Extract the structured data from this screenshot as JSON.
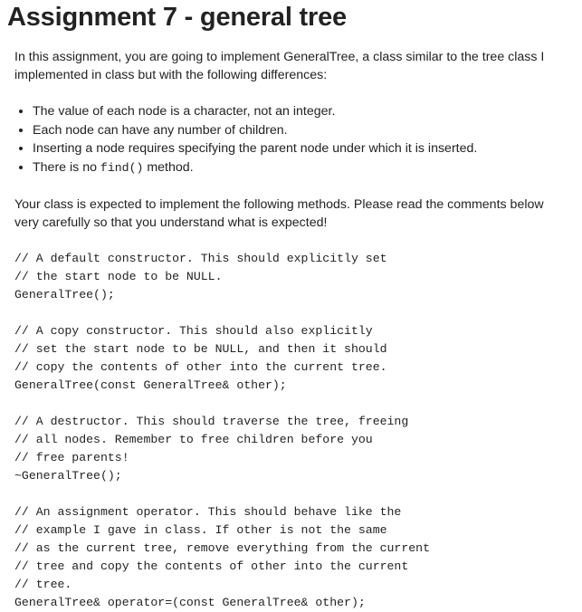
{
  "title": "Assignment 7 - general tree",
  "intro": "In this assignment, you are going to implement GeneralTree, a class similar to the tree class I implemented in class but with the following differences:",
  "differences": [
    {
      "text_before": "The value of each node is a character, not an integer.",
      "code": "",
      "text_after": ""
    },
    {
      "text_before": "Each node can have any number of children.",
      "code": "",
      "text_after": ""
    },
    {
      "text_before": "Inserting a node requires specifying the parent node under which it is inserted.",
      "code": "",
      "text_after": ""
    },
    {
      "text_before": "There is no ",
      "code": "find()",
      "text_after": " method."
    }
  ],
  "methods_intro": "Your class is expected to implement the following methods. Please read the comments below very carefully so that you understand what is expected!",
  "code_blocks": [
    [
      "// A default constructor. This should explicitly set",
      "// the start node to be NULL.",
      "GeneralTree();"
    ],
    [
      "// A copy constructor. This should also explicitly",
      "// set the start node to be NULL, and then it should",
      "// copy the contents of other into the current tree.",
      "GeneralTree(const GeneralTree& other);"
    ],
    [
      "// A destructor. This should traverse the tree, freeing",
      "// all nodes. Remember to free children before you",
      "// free parents!",
      "~GeneralTree();"
    ],
    [
      "// An assignment operator. This should behave like the",
      "// example I gave in class. If other is not the same",
      "// as the current tree, remove everything from the current",
      "// tree and copy the contents of other into the current",
      "// tree.",
      "GeneralTree& operator=(const GeneralTree& other);"
    ]
  ],
  "colors": {
    "text": "#222222",
    "background": "#ffffff"
  }
}
